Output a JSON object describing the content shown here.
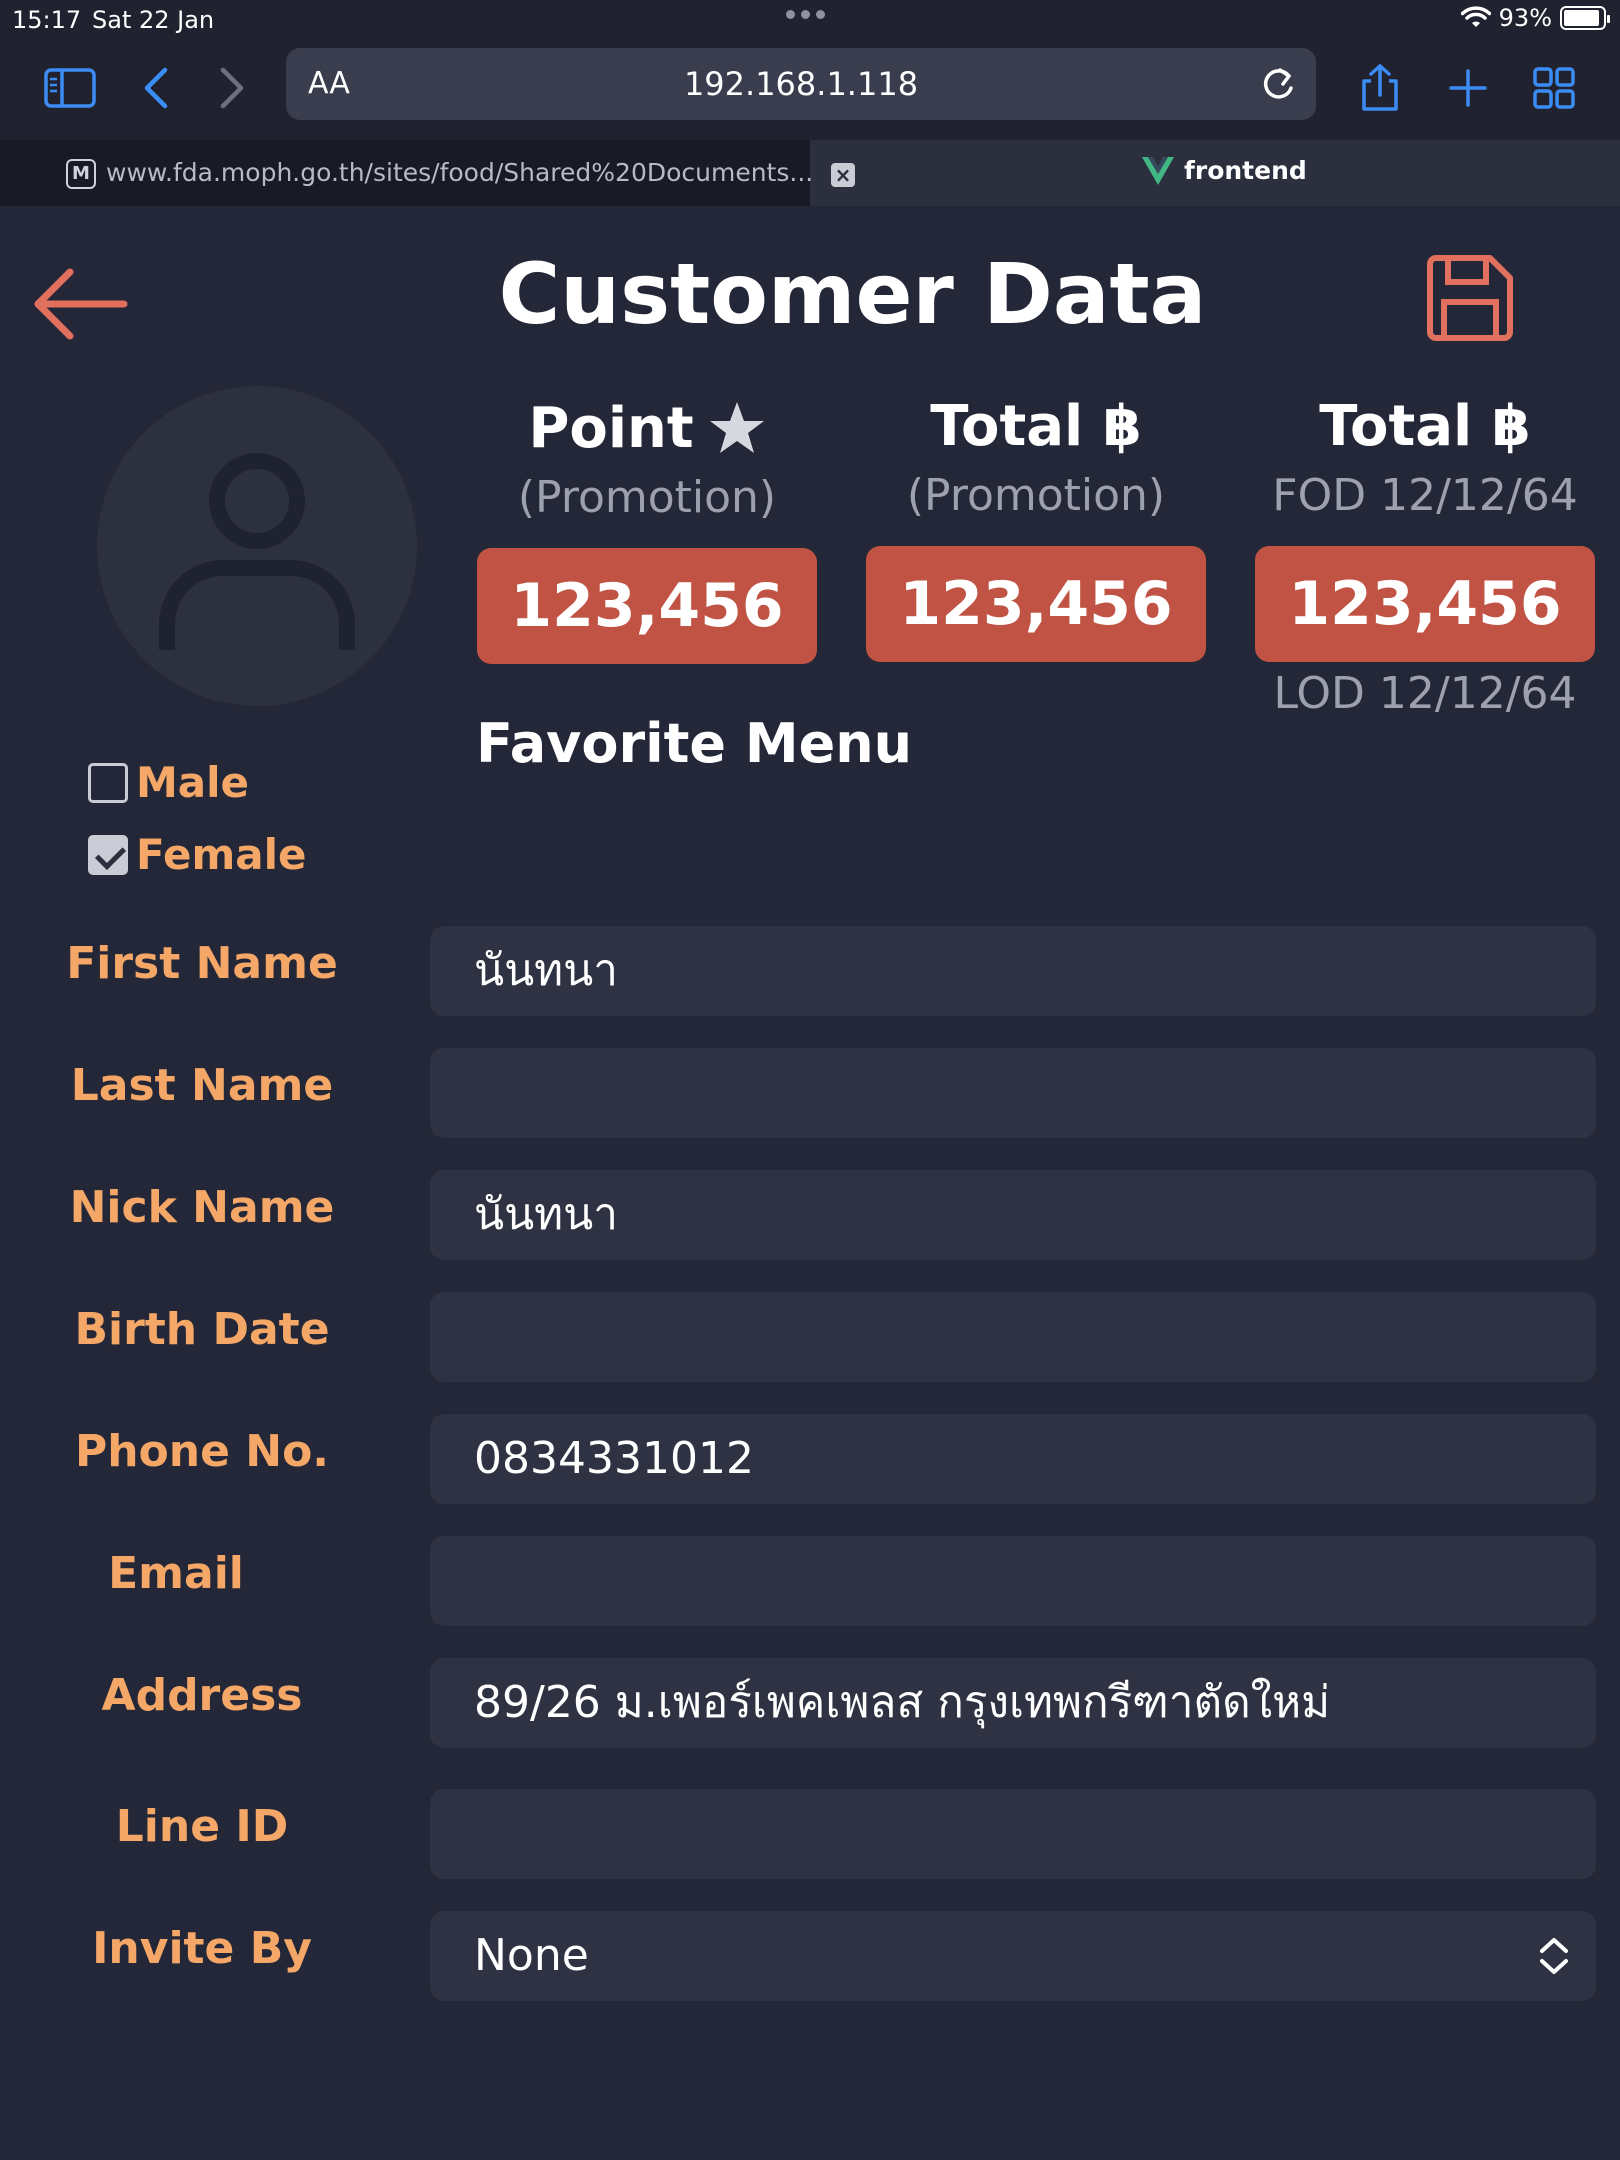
{
  "status_bar": {
    "time": "15:17",
    "date": "Sat 22 Jan",
    "battery": "93%",
    "battery_level": 0.93
  },
  "browser": {
    "address_aa": "AA",
    "url": "192.168.1.118",
    "tabs": [
      {
        "favicon": "M",
        "title": "www.fda.moph.go.th/sites/food/Shared%20Documents...",
        "active": true
      },
      {
        "title": "frontend",
        "active": false
      }
    ]
  },
  "page": {
    "title": "Customer Data"
  },
  "stats": [
    {
      "title": "Point",
      "subtitle": "(Promotion)",
      "value": "123,456",
      "footer": ""
    },
    {
      "title": "Total ฿",
      "subtitle": "(Promotion)",
      "value": "123,456",
      "footer": ""
    },
    {
      "title": "Total ฿",
      "subtitle": "FOD 12/12/64",
      "value": "123,456",
      "footer": "LOD 12/12/64"
    }
  ],
  "favorite_menu": {
    "title": "Favorite Menu"
  },
  "gender": {
    "male": {
      "label": "Male",
      "checked": false
    },
    "female": {
      "label": "Female",
      "checked": true
    }
  },
  "form": {
    "first_name": {
      "label": "First Name",
      "value": "นันทนา"
    },
    "last_name": {
      "label": "Last Name",
      "value": ""
    },
    "nick_name": {
      "label": "Nick Name",
      "value": "นันทนา"
    },
    "birth_date": {
      "label": "Birth Date",
      "value": ""
    },
    "phone": {
      "label": "Phone No.",
      "value": "0834331012"
    },
    "email": {
      "label": "Email",
      "value": ""
    },
    "address": {
      "label": "Address",
      "value": "89/26 ม.เพอร์เพคเพลส กรุงเทพกรีฑาตัดใหม่"
    },
    "line_id": {
      "label": "Line ID",
      "value": ""
    },
    "invite_by": {
      "label": "Invite By",
      "value": "None"
    }
  },
  "colors": {
    "background": "#242737",
    "accent_orange": "#f4a767",
    "value_red": "#c05344",
    "icon_red": "#e2705f",
    "ios_blue": "#3b8cf5"
  },
  "icons": {
    "back": "arrow-left-icon",
    "save": "floppy-disk-icon",
    "avatar": "user-icon",
    "point": "star-icon"
  }
}
